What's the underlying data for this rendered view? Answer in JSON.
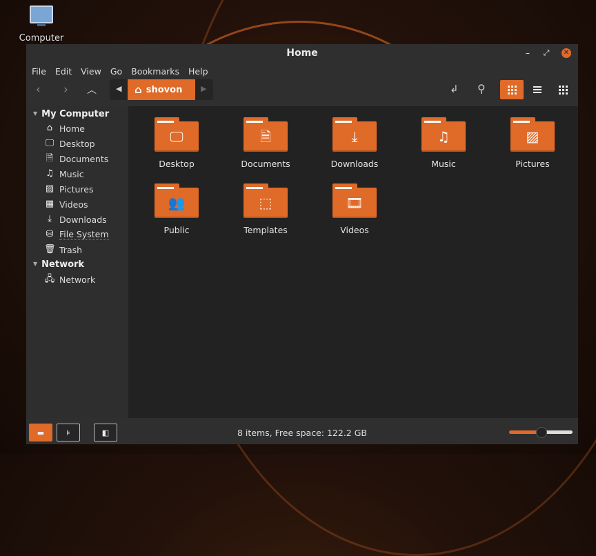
{
  "desktop": {
    "icons": [
      {
        "label": "Computer",
        "icon": "computer-monitor-icon"
      }
    ]
  },
  "window": {
    "title": "Home",
    "controls": {
      "minimize": "–",
      "maximize": "⤢",
      "close": "✕"
    }
  },
  "menubar": {
    "items": [
      "File",
      "Edit",
      "View",
      "Go",
      "Bookmarks",
      "Help"
    ]
  },
  "toolbar": {
    "back": "‹",
    "forward": "›",
    "up": "︿",
    "breadcrumb": {
      "current": "shovon",
      "icon": "home-icon"
    },
    "buttons": [
      "toggle-location-icon",
      "search-icon",
      "icon-view-icon",
      "list-view-icon",
      "compact-view-icon"
    ],
    "active_view": "icon-view"
  },
  "sidebar": {
    "sections": [
      {
        "title": "My Computer",
        "items": [
          {
            "label": "Home",
            "icon": "home-icon"
          },
          {
            "label": "Desktop",
            "icon": "desktop-icon"
          },
          {
            "label": "Documents",
            "icon": "document-icon"
          },
          {
            "label": "Music",
            "icon": "music-icon"
          },
          {
            "label": "Pictures",
            "icon": "picture-icon"
          },
          {
            "label": "Videos",
            "icon": "video-icon"
          },
          {
            "label": "Downloads",
            "icon": "download-icon"
          },
          {
            "label": "File System",
            "icon": "harddisk-icon"
          },
          {
            "label": "Trash",
            "icon": "trash-icon"
          }
        ]
      },
      {
        "title": "Network",
        "items": [
          {
            "label": "Network",
            "icon": "network-icon"
          }
        ]
      }
    ]
  },
  "files": [
    {
      "name": "Desktop",
      "glyph": "🖵"
    },
    {
      "name": "Documents",
      "glyph": "🗎"
    },
    {
      "name": "Downloads",
      "glyph": "⤓"
    },
    {
      "name": "Music",
      "glyph": "♫"
    },
    {
      "name": "Pictures",
      "glyph": "▨"
    },
    {
      "name": "Public",
      "glyph": "👥"
    },
    {
      "name": "Templates",
      "glyph": "⬚"
    },
    {
      "name": "Videos",
      "glyph": "🎞"
    }
  ],
  "statusbar": {
    "text": "8 items, Free space: 122.2 GB",
    "zoom_level_fraction": 0.5,
    "active_pane": "places"
  },
  "colors": {
    "accent": "#e06a28",
    "window_bg": "#2f2f2f",
    "content_bg": "#222222"
  }
}
